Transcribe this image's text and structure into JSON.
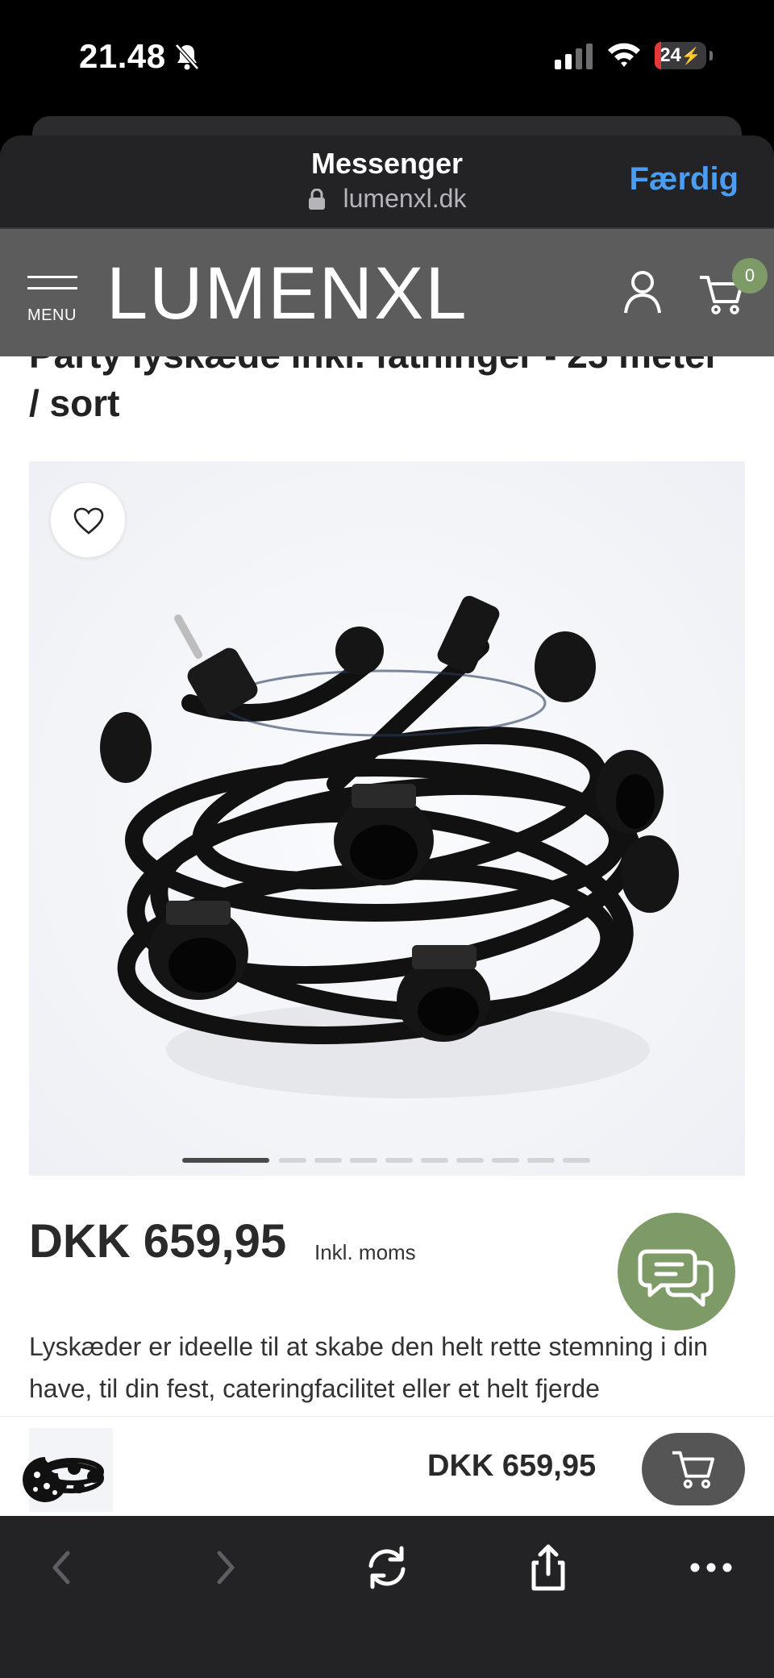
{
  "status_bar": {
    "time": "21.48",
    "battery": "24"
  },
  "browser": {
    "title": "Messenger",
    "url": "lumenxl.dk",
    "done_label": "Færdig"
  },
  "site_header": {
    "menu_label": "MENU",
    "logo": "LUMENXL",
    "cart_count": "0"
  },
  "product": {
    "title": "Party lyskæde inkl. fatninger - 25 meter / sort",
    "gallery": {
      "image_count": 10,
      "current_index": 1
    },
    "price": "DKK 659,95",
    "price_note": "Inkl. moms",
    "description": "Lyskæder er ideelle til at skabe den helt rette stemning i din have, til din fest, cateringfacilitet eller et helt fjerde"
  },
  "buy_bar": {
    "price": "DKK 659,95"
  },
  "colors": {
    "header_bg": "#5c5c5c",
    "accent_green": "#7e9a67",
    "link_blue": "#4a9df0"
  },
  "icons": [
    "bell-mute-icon",
    "signal-icon",
    "wifi-icon",
    "lock-icon",
    "user-icon",
    "cart-icon",
    "heart-icon",
    "chat-icon",
    "cookie-icon",
    "back-icon",
    "forward-icon",
    "reload-icon",
    "share-icon",
    "more-icon"
  ]
}
